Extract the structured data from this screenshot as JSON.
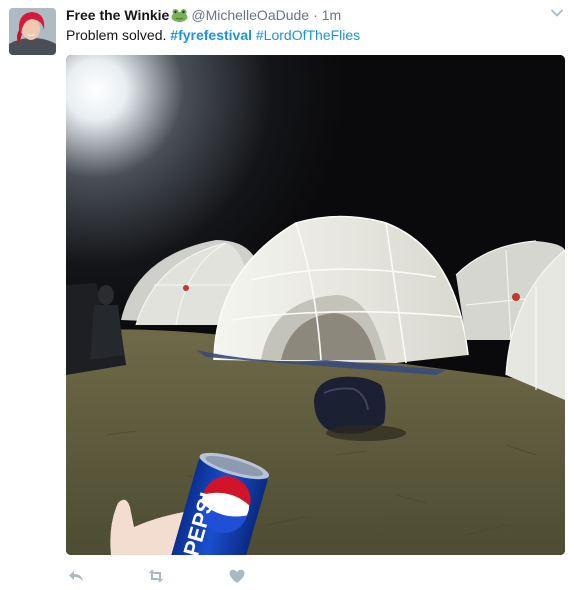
{
  "tweet": {
    "display_name": "Free the Winkie",
    "handle": "@MichelleOaDude",
    "separator": "·",
    "timestamp": "1m",
    "text_plain": "Problem solved.",
    "hashtag_1": "#fyrefestival",
    "hashtag_2": "#LordOfTheFlies",
    "can_text": "PEPSI"
  },
  "icons": [
    "frog-emoji-icon",
    "caret-down-icon",
    "reply-icon",
    "retweet-icon",
    "like-icon"
  ],
  "colors": {
    "link": "#1b95e0",
    "secondary": "#657786",
    "icon": "#aab8c2",
    "text": "#14171a"
  }
}
